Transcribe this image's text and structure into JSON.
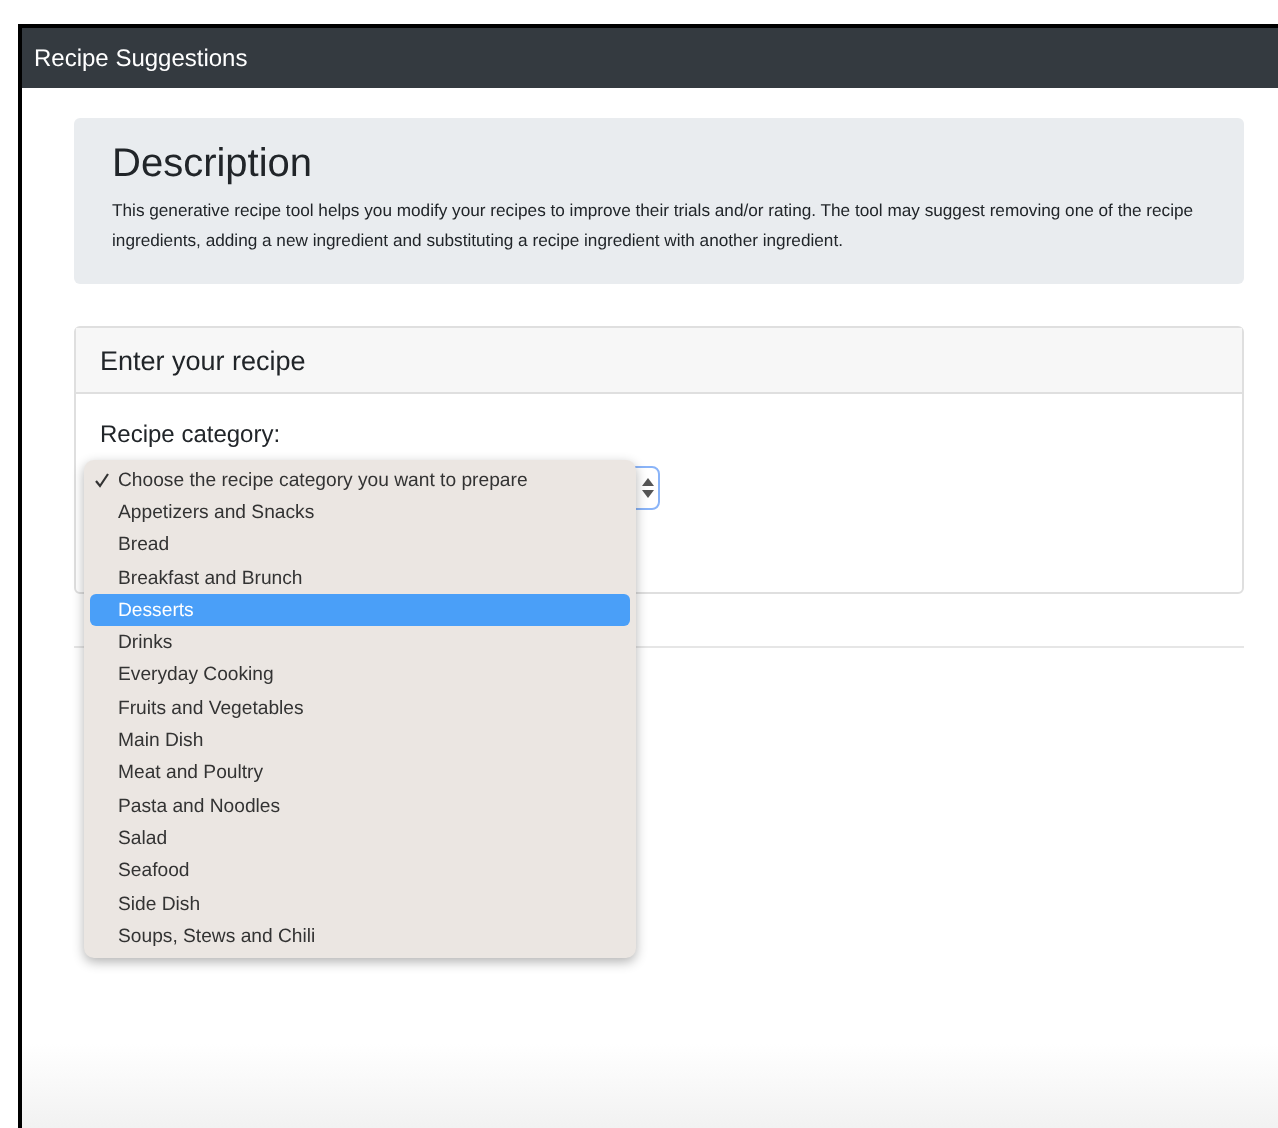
{
  "window": {
    "title": "Recipe Suggestions"
  },
  "description": {
    "heading": "Description",
    "text": "This generative recipe tool helps you modify your recipes to improve their trials and/or rating. The tool may suggest removing one of the recipe ingredients, adding a new ingredient and substituting a recipe ingredient with another ingredient."
  },
  "recipe_card": {
    "title": "Enter your recipe",
    "category_label": "Recipe category:"
  },
  "category_dropdown": {
    "options": [
      {
        "label": "Choose the recipe category you want to prepare",
        "checked": true,
        "selected": false
      },
      {
        "label": "Appetizers and Snacks",
        "checked": false,
        "selected": false
      },
      {
        "label": "Bread",
        "checked": false,
        "selected": false
      },
      {
        "label": "Breakfast and Brunch",
        "checked": false,
        "selected": false
      },
      {
        "label": "Desserts",
        "checked": false,
        "selected": true
      },
      {
        "label": "Drinks",
        "checked": false,
        "selected": false
      },
      {
        "label": "Everyday Cooking",
        "checked": false,
        "selected": false
      },
      {
        "label": "Fruits and Vegetables",
        "checked": false,
        "selected": false
      },
      {
        "label": "Main Dish",
        "checked": false,
        "selected": false
      },
      {
        "label": "Meat and Poultry",
        "checked": false,
        "selected": false
      },
      {
        "label": "Pasta and Noodles",
        "checked": false,
        "selected": false
      },
      {
        "label": "Salad",
        "checked": false,
        "selected": false
      },
      {
        "label": "Seafood",
        "checked": false,
        "selected": false
      },
      {
        "label": "Side Dish",
        "checked": false,
        "selected": false
      },
      {
        "label": "Soups, Stews and Chili",
        "checked": false,
        "selected": false
      }
    ]
  }
}
